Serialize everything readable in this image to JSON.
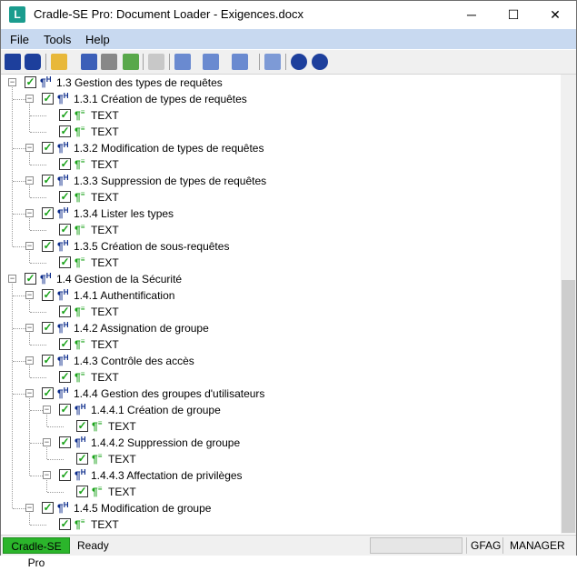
{
  "window": {
    "title": "Cradle-SE Pro: Document Loader - Exigences.docx",
    "app_icon_letter": "L",
    "controls": {
      "minimize": "─",
      "maximize": "☐",
      "close": "✕"
    }
  },
  "menu": [
    "File",
    "Tools",
    "Help"
  ],
  "toolbar": {
    "icons": [
      "pin-icon",
      "power-icon",
      "open-folder-icon",
      "save-icon",
      "tools-icon",
      "export-icon",
      "stop-icon",
      "tree-expand-icon",
      "tree-collapse-icon",
      "tree-level-icon",
      "panel-icon",
      "help-icon",
      "info-icon"
    ]
  },
  "tree": {
    "rows": [
      {
        "level": 0,
        "label": "1.3 Gestion des types de requêtes",
        "kind": "heading",
        "expander": "⊟"
      },
      {
        "level": 1,
        "label": "1.3.1 Création de types de requêtes",
        "kind": "heading",
        "expander": "⊟"
      },
      {
        "level": 2,
        "label": "TEXT",
        "kind": "text"
      },
      {
        "level": 2,
        "label": "TEXT",
        "kind": "text"
      },
      {
        "level": 1,
        "label": "1.3.2 Modification de types de requêtes",
        "kind": "heading",
        "expander": "⊟"
      },
      {
        "level": 2,
        "label": "TEXT",
        "kind": "text"
      },
      {
        "level": 1,
        "label": "1.3.3 Suppression de types de requêtes",
        "kind": "heading",
        "expander": "⊟"
      },
      {
        "level": 2,
        "label": "TEXT",
        "kind": "text"
      },
      {
        "level": 1,
        "label": "1.3.4 Lister les types",
        "kind": "heading",
        "expander": "⊟"
      },
      {
        "level": 2,
        "label": "TEXT",
        "kind": "text"
      },
      {
        "level": 1,
        "label": "1.3.5 Création de sous-requêtes",
        "kind": "heading",
        "expander": "⊟"
      },
      {
        "level": 2,
        "label": "TEXT",
        "kind": "text"
      },
      {
        "level": 0,
        "label": "1.4 Gestion de la Sécurité",
        "kind": "heading",
        "expander": "⊟"
      },
      {
        "level": 1,
        "label": "1.4.1 Authentification",
        "kind": "heading",
        "expander": "⊟"
      },
      {
        "level": 2,
        "label": "TEXT",
        "kind": "text"
      },
      {
        "level": 1,
        "label": "1.4.2 Assignation de groupe",
        "kind": "heading",
        "expander": "⊟"
      },
      {
        "level": 2,
        "label": "TEXT",
        "kind": "text"
      },
      {
        "level": 1,
        "label": "1.4.3 Contrôle des accès",
        "kind": "heading",
        "expander": "⊟"
      },
      {
        "level": 2,
        "label": "TEXT",
        "kind": "text"
      },
      {
        "level": 1,
        "label": "1.4.4 Gestion des groupes d'utilisateurs",
        "kind": "heading",
        "expander": "⊟"
      },
      {
        "level": 2,
        "label": "1.4.4.1 Création de groupe",
        "kind": "heading",
        "expander": "⊟"
      },
      {
        "level": 3,
        "label": "TEXT",
        "kind": "text"
      },
      {
        "level": 2,
        "label": "1.4.4.2 Suppression de groupe",
        "kind": "heading",
        "expander": "⊟"
      },
      {
        "level": 3,
        "label": "TEXT",
        "kind": "text"
      },
      {
        "level": 2,
        "label": "1.4.4.3 Affectation de privilèges",
        "kind": "heading",
        "expander": "⊟"
      },
      {
        "level": 3,
        "label": "TEXT",
        "kind": "text"
      },
      {
        "level": 1,
        "label": "1.4.5 Modification de groupe",
        "kind": "heading",
        "expander": "⊟"
      },
      {
        "level": 2,
        "label": "TEXT",
        "kind": "text"
      }
    ],
    "heading_icon": "¶",
    "heading_sup": "H",
    "text_icon": "¶",
    "text_sup": "≡",
    "check_mark": "✓"
  },
  "status": {
    "app": "Cradle-SE Pro",
    "state": "Ready",
    "user_group": "GFAG",
    "role": "MANAGER"
  },
  "colors": {
    "menu_bg": "#c8d9f0",
    "status_app_bg": "#2bb52b",
    "check": "#1aa31a"
  }
}
